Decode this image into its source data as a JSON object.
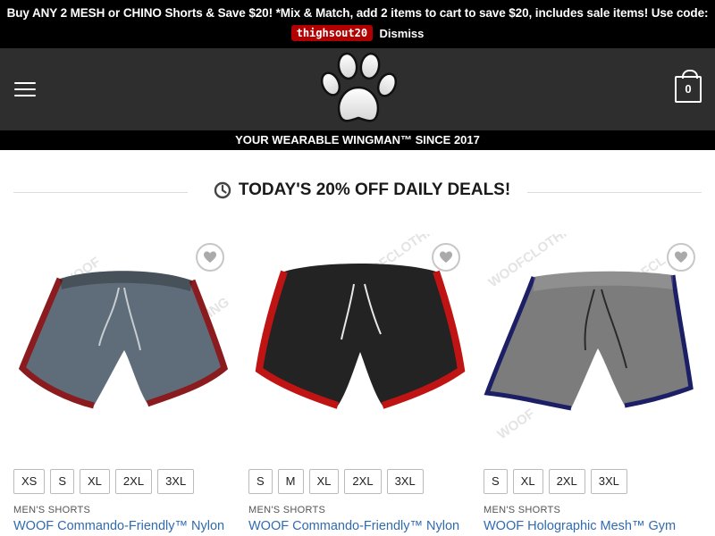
{
  "promo": {
    "message": "Buy ANY 2 MESH or CHINO Shorts & Save $20! *Mix & Match, add 2 items to cart to save $20, includes sale items! Use code:",
    "code": "thighsout20",
    "dismiss_label": "Dismiss"
  },
  "header": {
    "cart_count": "0",
    "tagline": "YOUR WEARABLE WINGMAN™ SINCE 2017"
  },
  "section": {
    "title": "TODAY'S 20% OFF DAILY DEALS!"
  },
  "products": [
    {
      "category": "MEN'S SHORTS",
      "name": "WOOF Commando-Friendly™ Nylon",
      "sizes": [
        "XS",
        "S",
        "XL",
        "2XL",
        "3XL"
      ],
      "colors": {
        "body": "#5f6c79",
        "trim": "#8a1c1f",
        "string": "#c8cdd2"
      }
    },
    {
      "category": "MEN'S SHORTS",
      "name": "WOOF Commando-Friendly™ Nylon",
      "sizes": [
        "S",
        "M",
        "XL",
        "2XL",
        "3XL"
      ],
      "colors": {
        "body": "#232323",
        "trim": "#c01414",
        "string": "#e8e8e8"
      }
    },
    {
      "category": "MEN'S SHORTS",
      "name": "WOOF Holographic Mesh™ Gym",
      "sizes": [
        "S",
        "XL",
        "2XL",
        "3XL"
      ],
      "colors": {
        "body": "#7c7c7c",
        "trim": "#1c1f66",
        "string": "#2a2a2a"
      }
    }
  ],
  "icons": {
    "menu": "hamburger-icon",
    "logo": "paw-logo",
    "cart": "cart-bag-icon",
    "clock": "clock-icon",
    "wishlist": "heart-icon"
  }
}
